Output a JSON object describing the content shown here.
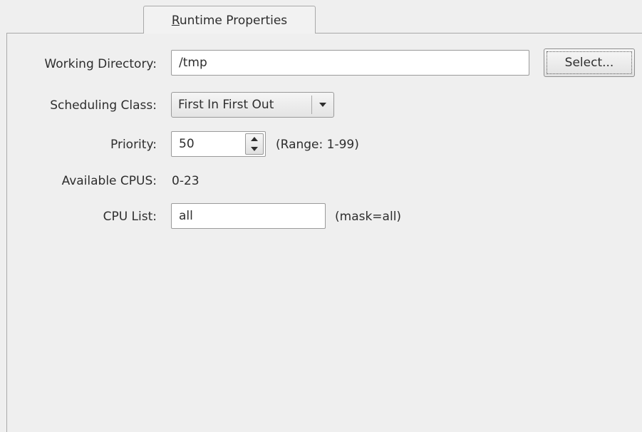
{
  "tabs": {
    "active": {
      "mnemonic": "R",
      "rest": "untime Properties"
    }
  },
  "form": {
    "working_directory": {
      "label": "Working Directory:",
      "value": "/tmp",
      "button_label": "Select..."
    },
    "scheduling_class": {
      "label": "Scheduling Class:",
      "selected": "First In First Out"
    },
    "priority": {
      "label": "Priority:",
      "value": "50",
      "range_text": "(Range: 1-99)"
    },
    "available_cpus": {
      "label": "Available CPUS:",
      "value": "0-23"
    },
    "cpu_list": {
      "label": "CPU List:",
      "value": "all",
      "mask_text": "(mask=all)"
    }
  },
  "icons": {
    "combo_arrow": "chevron-down-icon",
    "spin_up": "caret-up-icon",
    "spin_down": "caret-down-icon"
  }
}
